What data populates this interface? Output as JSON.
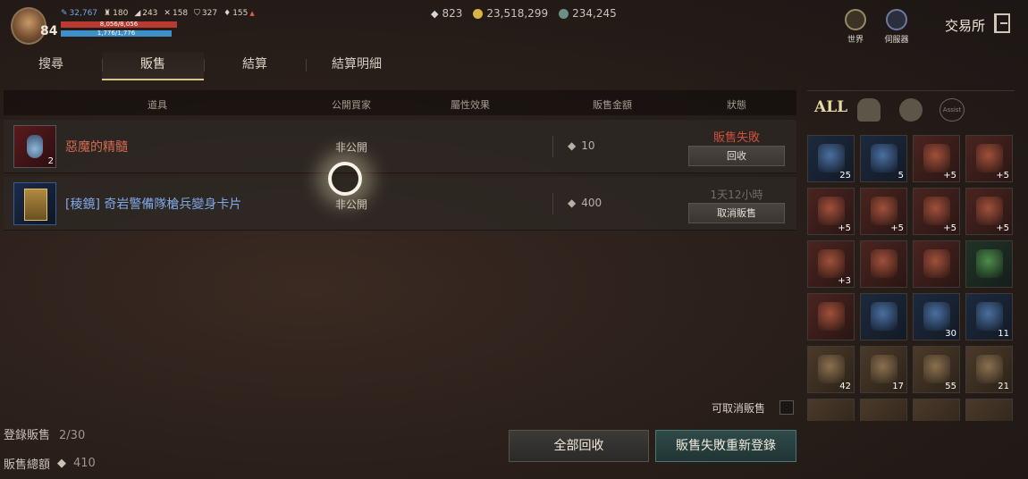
{
  "player": {
    "level": "84",
    "hp_text": "8,056/8,056",
    "mp_text": "1,776/1,776",
    "stats": [
      {
        "icon": "feather-icon",
        "value": "32,767",
        "color": "#6fa8e8"
      },
      {
        "icon": "weight-icon",
        "value": "180"
      },
      {
        "icon": "boot-icon",
        "value": "243"
      },
      {
        "icon": "crossed-swords-icon",
        "value": "158"
      },
      {
        "icon": "shield-icon",
        "value": "327"
      },
      {
        "icon": "diamond-icon",
        "value": "155",
        "extra": "▲"
      }
    ]
  },
  "currency": {
    "diamond": "823",
    "gold": "23,518,299",
    "gem": "234,245"
  },
  "header": {
    "world_label": "世界",
    "server_label": "伺服器",
    "title": "交易所"
  },
  "tabs": [
    {
      "label": "搜尋",
      "active": false
    },
    {
      "label": "販售",
      "active": true
    },
    {
      "label": "結算",
      "active": false
    },
    {
      "label": "結算明細",
      "active": false
    }
  ],
  "table": {
    "headers": [
      "道具",
      "公開買家",
      "屬性效果",
      "販售金額",
      "狀態"
    ],
    "rows": [
      {
        "name": "惡魔的精髓",
        "qty": "2",
        "buyer": "非公開",
        "price": "10",
        "status": "販售失敗",
        "button": "回收"
      },
      {
        "name": "[稜鏡] 奇岩警備隊槍兵變身卡片",
        "qty": "",
        "buyer": "非公開",
        "price": "400",
        "status": "1天12小時",
        "button": "取消販售"
      }
    ]
  },
  "footer": {
    "cancelable_label": "可取消販售",
    "registered_label": "登錄販售",
    "registered_value": "2/30",
    "total_label": "販售總額",
    "total_value": "410",
    "collect_all": "全部回收",
    "reregister": "販售失敗重新登錄"
  },
  "inventory": {
    "tabs": [
      "ALL",
      "helmet",
      "bag",
      "Assist"
    ],
    "slots": [
      {
        "color": "blue",
        "count": "25"
      },
      {
        "color": "blue",
        "count": "5"
      },
      {
        "color": "red",
        "count": "+5"
      },
      {
        "color": "red",
        "count": "+5"
      },
      {
        "color": "red",
        "count": "+5"
      },
      {
        "color": "red",
        "count": "+5"
      },
      {
        "color": "red",
        "count": "+5"
      },
      {
        "color": "red",
        "count": "+5"
      },
      {
        "color": "red",
        "count": "+3"
      },
      {
        "color": "red",
        "count": ""
      },
      {
        "color": "red",
        "count": ""
      },
      {
        "color": "green",
        "count": ""
      },
      {
        "color": "red",
        "count": ""
      },
      {
        "color": "blue",
        "count": ""
      },
      {
        "color": "blue",
        "count": "30"
      },
      {
        "color": "blue",
        "count": "11"
      },
      {
        "color": "tan",
        "count": "42"
      },
      {
        "color": "tan",
        "count": "17"
      },
      {
        "color": "tan",
        "count": "55"
      },
      {
        "color": "tan",
        "count": "21"
      }
    ]
  }
}
